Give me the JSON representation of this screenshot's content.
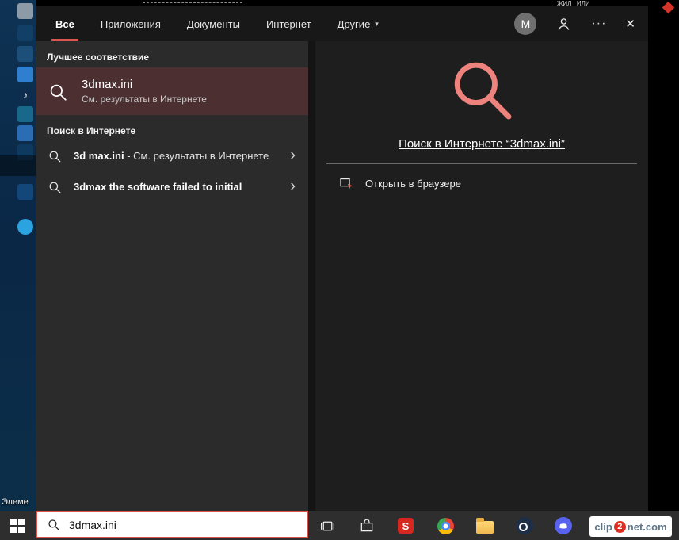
{
  "colors": {
    "accent": "#dd574f",
    "magnifier": "#ee827d",
    "highlight_row": "#4c2f31",
    "left_panel_bg": "#2b2b2b",
    "right_panel_bg": "#1e1e1e",
    "search_border": "#d6534c",
    "taskbar_bg": "#2e2e2e"
  },
  "topbar": {
    "tabs": [
      {
        "label": "Все"
      },
      {
        "label": "Приложения"
      },
      {
        "label": "Документы"
      },
      {
        "label": "Интернет"
      },
      {
        "label": "Другие"
      }
    ],
    "dropdown_arrow": "▾",
    "avatar_letter": "M",
    "ellipsis": "···",
    "close": "✕"
  },
  "left_panel": {
    "best_match_header": "Лучшее соответствие",
    "best_match": {
      "title": "3dmax.ini",
      "subtitle": "См. результаты в Интернете"
    },
    "web_header": "Поиск в Интернете",
    "suggestions": [
      {
        "bold": "3d max.ini",
        "rest": " - См. результаты в Интернете"
      },
      {
        "bold": "3dmax the software failed to initial",
        "rest": ""
      }
    ],
    "chevron": "›"
  },
  "right_panel": {
    "link": "Поиск в Интернете “3dmax.ini”",
    "open_in_browser": "Открыть в браузере"
  },
  "search_box": {
    "value": "3dmax.ini"
  },
  "desktop": {
    "partial_label": "Элеме",
    "music_note": "♪"
  },
  "taskbar": {
    "s_badge": "S"
  },
  "watermark": {
    "pre": "clip",
    "num": "2",
    "post": "net.com"
  },
  "fragments": {
    "top_text": "ЖИЛ | ИЛИ"
  }
}
